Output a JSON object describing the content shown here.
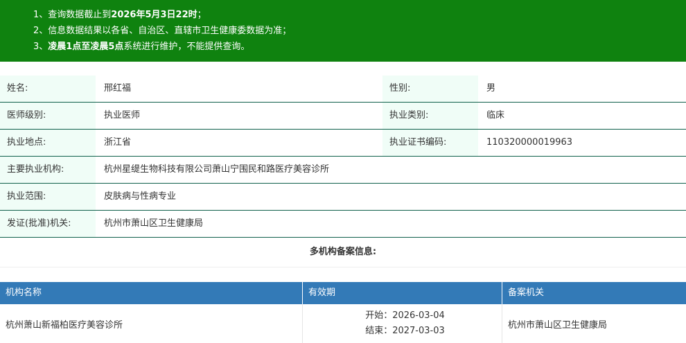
{
  "notice": {
    "line1_prefix": "1、查询数据截止到",
    "line1_bold": "2026年5月3日22时",
    "line1_suffix": "；",
    "line2": "2、信息数据结果以各省、自治区、直辖市卫生健康委数据为准；",
    "line3_prefix": "3、",
    "line3_bold": "凌晨1点至凌晨5点",
    "line3_suffix": "系统进行维护，不能提供查询。"
  },
  "info": {
    "name_label": "姓名:",
    "name_value": "邢红福",
    "gender_label": "性别:",
    "gender_value": "男",
    "level_label": "医师级别:",
    "level_value": "执业医师",
    "category_label": "执业类别:",
    "category_value": "临床",
    "location_label": "执业地点:",
    "location_value": "浙江省",
    "cert_label": "执业证书编码:",
    "cert_value": "110320000019963",
    "org_label": "主要执业机构:",
    "org_value": "杭州星缇生物科技有限公司萧山宁围民和路医疗美容诊所",
    "scope_label": "执业范围:",
    "scope_value": "皮肤病与性病专业",
    "issuer_label": "发证(批准)机关:",
    "issuer_value": "杭州市萧山区卫生健康局"
  },
  "multi": {
    "title": "多机构备案信息:"
  },
  "registry": {
    "headers": [
      "机构名称",
      "有效期",
      "备案机关"
    ],
    "rows": [
      {
        "org": "杭州萧山新福柏医疗美容诊所",
        "start": "开始：2026-03-04",
        "end": "结束：2027-03-03",
        "authority": "杭州市萧山区卫生健康局"
      }
    ]
  }
}
